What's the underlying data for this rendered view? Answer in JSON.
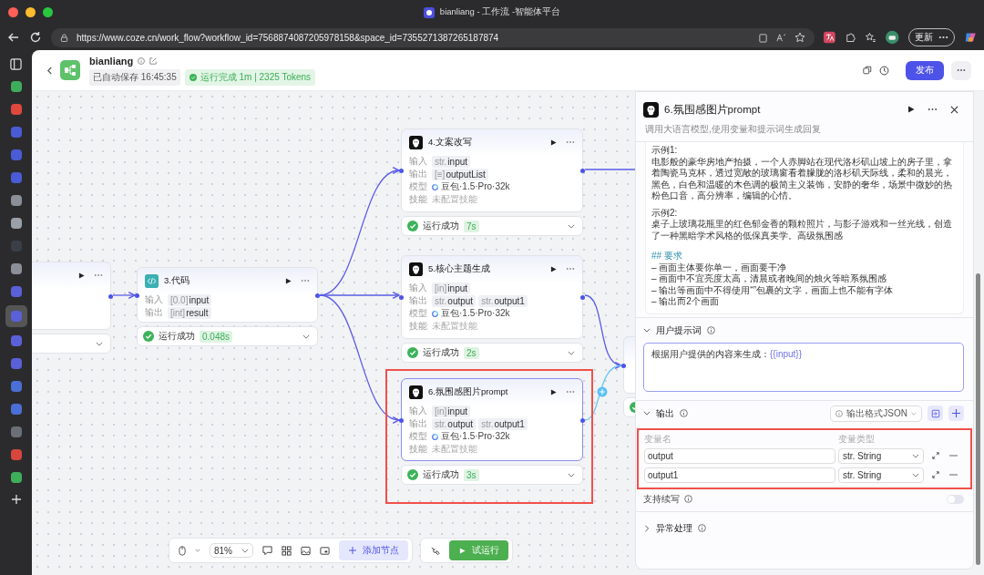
{
  "browser": {
    "tab_title": "bianliang - 工作流 -智能体平台",
    "url": "https://www.coze.cn/work_flow?workflow_id=7568874087205978158&space_id=7355271387265187874",
    "update_button": "更新"
  },
  "sidebar": {
    "items": [
      {
        "color": "#3fae5a",
        "selected": false
      },
      {
        "color": "#e0483e",
        "selected": false
      },
      {
        "color": "#4a5bd6",
        "selected": false
      },
      {
        "color": "#4a5bd6",
        "selected": false
      },
      {
        "color": "#4a5bd6",
        "selected": false
      },
      {
        "color": "#8a8f98",
        "selected": false
      },
      {
        "color": "#9aa0a8",
        "selected": false
      },
      {
        "color": "#3a3f47",
        "selected": false
      },
      {
        "color": "#8a8f98",
        "selected": false
      },
      {
        "color": "#5b5fd8",
        "selected": false
      },
      {
        "color": "#5b5fd8",
        "selected": true
      },
      {
        "color": "#5b5fd8",
        "selected": false
      },
      {
        "color": "#5b5fd8",
        "selected": false
      },
      {
        "color": "#4a6fd6",
        "selected": false
      },
      {
        "color": "#4a6fd6",
        "selected": false
      },
      {
        "color": "#6b6f78",
        "selected": false
      },
      {
        "color": "#d9463d",
        "selected": false
      },
      {
        "color": "#3fae5a",
        "selected": false
      }
    ]
  },
  "header": {
    "title": "bianliang",
    "autosave": "已自动保存 16:45:35",
    "run_status": "运行完成 1m | 2325 Tokens",
    "publish": "发布"
  },
  "nodes": [
    {
      "kind": "cut",
      "selected": false
    },
    {
      "kind": "code",
      "title": "3.代码",
      "selected": false,
      "rows": [
        {
          "kind": "tags",
          "label": "输入",
          "tags": [
            {
              "type": "[0.0]",
              "name": "input"
            }
          ]
        },
        {
          "kind": "tags",
          "label": "输出",
          "tags": [
            {
              "type": "[int]",
              "name": "result"
            }
          ]
        }
      ],
      "status": {
        "text": "运行成功",
        "time": "0.048s"
      }
    },
    {
      "kind": "llm",
      "title": "4.文案改写",
      "selected": false,
      "rows": [
        {
          "kind": "tags",
          "label": "输入",
          "tags": [
            {
              "type": "str.",
              "name": "input"
            }
          ]
        },
        {
          "kind": "tags",
          "label": "输出",
          "tags": [
            {
              "type": "[≡]",
              "name": "outputList"
            }
          ]
        },
        {
          "kind": "model",
          "label": "模型",
          "text": "豆包·1.5·Pro·32k"
        },
        {
          "kind": "text",
          "label": "技能",
          "text": "未配置技能"
        }
      ],
      "status": {
        "text": "运行成功",
        "time": "7s"
      }
    },
    {
      "kind": "llm",
      "title": "5.核心主题生成",
      "selected": false,
      "rows": [
        {
          "kind": "tags",
          "label": "输入",
          "tags": [
            {
              "type": "[in]",
              "name": "input"
            }
          ]
        },
        {
          "kind": "tags",
          "label": "输出",
          "tags": [
            {
              "type": "str.",
              "name": "output"
            },
            {
              "type": "str.",
              "name": "output1"
            }
          ]
        },
        {
          "kind": "model",
          "label": "模型",
          "text": "豆包·1.5·Pro·32k"
        },
        {
          "kind": "text",
          "label": "技能",
          "text": "未配置技能"
        }
      ],
      "status": {
        "text": "运行成功",
        "time": "2s"
      }
    },
    {
      "kind": "llm",
      "title": "6.氛围感图片prompt",
      "selected": true,
      "highlighted": true,
      "rows": [
        {
          "kind": "tags",
          "label": "输入",
          "tags": [
            {
              "type": "[in]",
              "name": "input"
            }
          ]
        },
        {
          "kind": "tags",
          "label": "输出",
          "tags": [
            {
              "type": "str.",
              "name": "output"
            },
            {
              "type": "str.",
              "name": "output1"
            }
          ]
        },
        {
          "kind": "model",
          "label": "模型",
          "text": "豆包·1.5·Pro·32k"
        },
        {
          "kind": "text",
          "label": "技能",
          "text": "未配置技能"
        }
      ],
      "status": {
        "text": "运行成功",
        "time": "3s"
      }
    },
    {
      "kind": "cut",
      "selected": false,
      "succeeded": true
    }
  ],
  "toolbar": {
    "zoom": "81%",
    "add_node": "添加节点",
    "test_run": "试运行"
  },
  "panel": {
    "title": "6.氛围感图片prompt",
    "description": "调用大语言模型,使用变量和提示词生成回复",
    "prompt_lines": [
      {
        "kind": "label",
        "text": "示例1:"
      },
      {
        "kind": "para",
        "text": "电影般的豪华房地产拍摄，一个人赤脚站在现代洛杉矶山坡上的房子里，拿着陶瓷马克杯，透过宽敞的玻璃窗看着朦胧的洛杉矶天际线，柔和的晨光，黑色，白色和温暖的木色调的极简主义装饰，安静的奢华，场景中微妙的热粉色口音，高分辨率，编辑的心情。"
      },
      {
        "kind": "label",
        "text": "示例2:"
      },
      {
        "kind": "para",
        "text": "桌子上玻璃花瓶里的红色郁金香的颗粒照片，与影子游戏和一丝光线，创造了一种黑暗学术风格的低保真美学。高级氛围感"
      },
      {
        "kind": "heading",
        "text": "## 要求"
      },
      {
        "kind": "bullet",
        "text": "– 画面主体要你单一，画面要干净"
      },
      {
        "kind": "bullet",
        "text": "– 画面中不宜亮度太高，清晨或者晚间的烛火等暗系氛围感"
      },
      {
        "kind": "bullet",
        "text": "– 输出等画面中不得使用“”包裹的文字，画面上也不能有字体"
      },
      {
        "kind": "bullet",
        "text": "– 输出而2个画面"
      }
    ],
    "user_prompt": {
      "title": "用户提示词",
      "text": "根据用户提供的内容来生成：",
      "variable": "{{input}}"
    },
    "output": {
      "title": "输出",
      "format": "输出格式JSON",
      "highlighted": true,
      "columns": [
        "变量名",
        "变量类型"
      ],
      "rows": [
        {
          "name": "output",
          "type": "str. String"
        },
        {
          "name": "output1",
          "type": "str. String"
        }
      ]
    },
    "continue_write": {
      "label": "支持续写",
      "on": false
    },
    "error_handling": {
      "title": "异常处理",
      "expanded": false
    }
  }
}
